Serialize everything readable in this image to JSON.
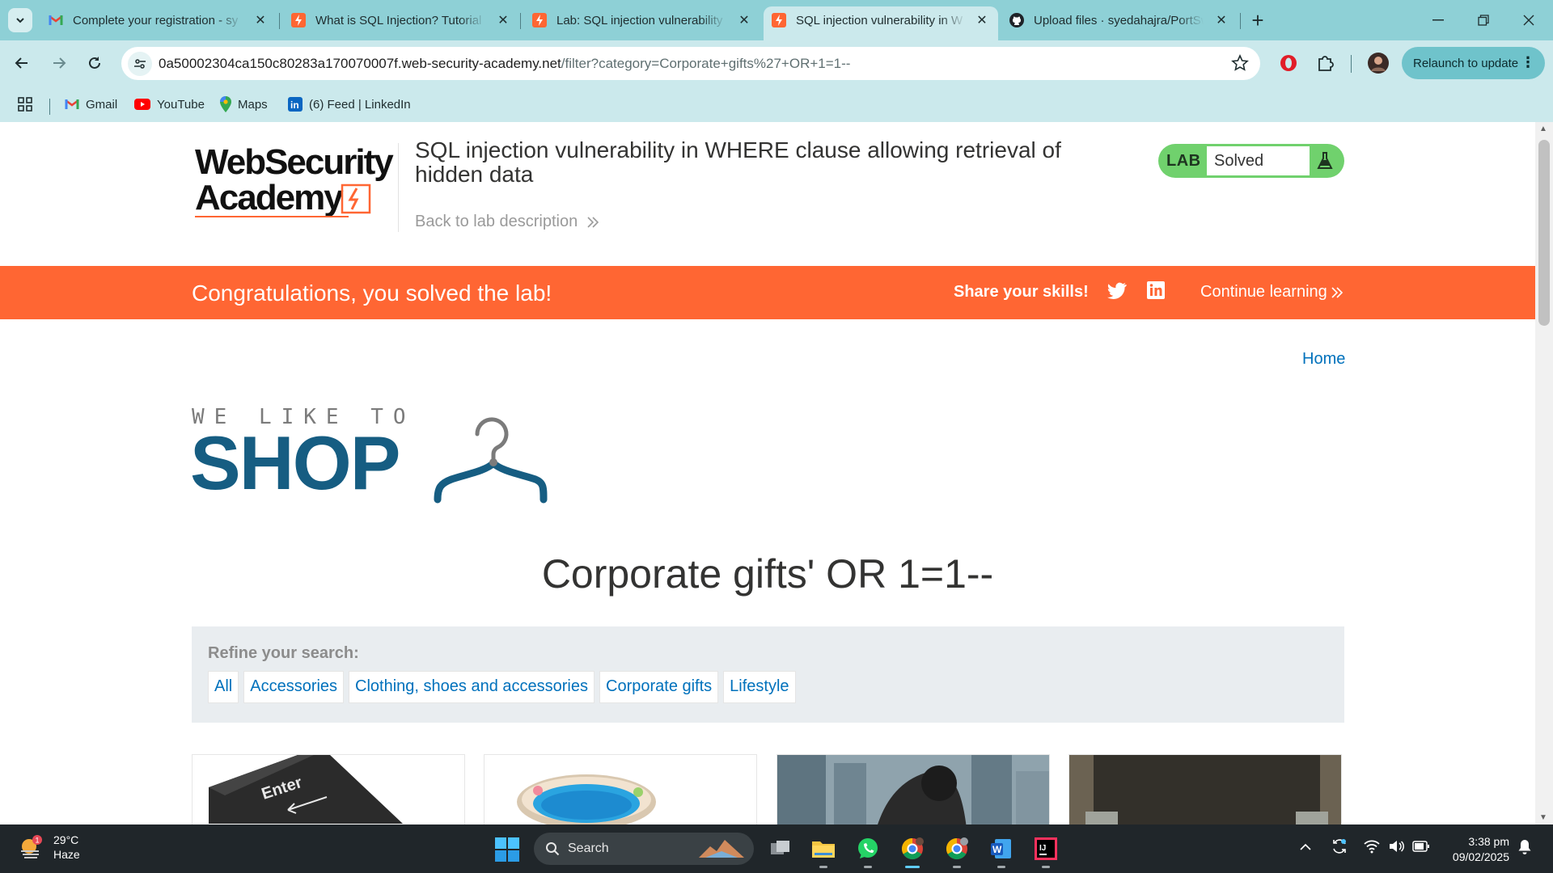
{
  "browser": {
    "tabs": [
      {
        "title": "Complete your registration - sy",
        "favicon": "gmail-icon"
      },
      {
        "title": "What is SQL Injection? Tutorial",
        "favicon": "portswigger-icon"
      },
      {
        "title": "Lab: SQL injection vulnerability",
        "favicon": "portswigger-icon"
      },
      {
        "title": "SQL injection vulnerability in W",
        "favicon": "portswigger-icon",
        "active": true
      },
      {
        "title": "Upload files · syedahajra/PortSw",
        "favicon": "github-icon"
      }
    ],
    "url_host": "0a50002304ca150c80283a170070007f.web-security-academy.net",
    "url_rest": "/filter?category=Corporate+gifts%27+OR+1=1--",
    "relaunch_label": "Relaunch to update",
    "bookmarks": [
      {
        "label": "Gmail",
        "icon": "gmail-icon"
      },
      {
        "label": "YouTube",
        "icon": "youtube-icon"
      },
      {
        "label": "Maps",
        "icon": "maps-icon"
      },
      {
        "label": "(6) Feed | LinkedIn",
        "icon": "linkedin-icon"
      }
    ]
  },
  "header": {
    "logo_line1": "WebSecurity",
    "logo_line2": "Academy",
    "lab_title": "SQL injection vulnerability in WHERE clause allowing retrieval of hidden data",
    "back_link": "Back to lab description",
    "lab_badge": "LAB",
    "lab_status": "Solved"
  },
  "banner": {
    "congrats": "Congratulations, you solved the lab!",
    "share": "Share your skills!",
    "continue": "Continue learning"
  },
  "shop": {
    "home_link": "Home",
    "tagline": "WE LIKE TO",
    "logo_word": "SHOP",
    "category_title": "Corporate gifts' OR 1=1--",
    "refine_label": "Refine your search:",
    "filters": [
      "All",
      "Accessories",
      "Clothing, shoes and accessories",
      "Corporate gifts",
      "Lifestyle"
    ],
    "product_images": [
      "enter-key-image",
      "paddling-pool-image",
      "city-skyline-image",
      "trousers-pocket-image"
    ]
  },
  "taskbar": {
    "weather_temp": "29°C",
    "weather_desc": "Haze",
    "weather_badge": "1",
    "search_placeholder": "Search",
    "time": "3:38 pm",
    "date": "09/02/2025"
  },
  "colors": {
    "browser_frame": "#8ed0d6",
    "banner": "#ff6633",
    "link": "#0071bc",
    "lab_solved": "#70d16d",
    "shop_logo": "#165d82"
  }
}
